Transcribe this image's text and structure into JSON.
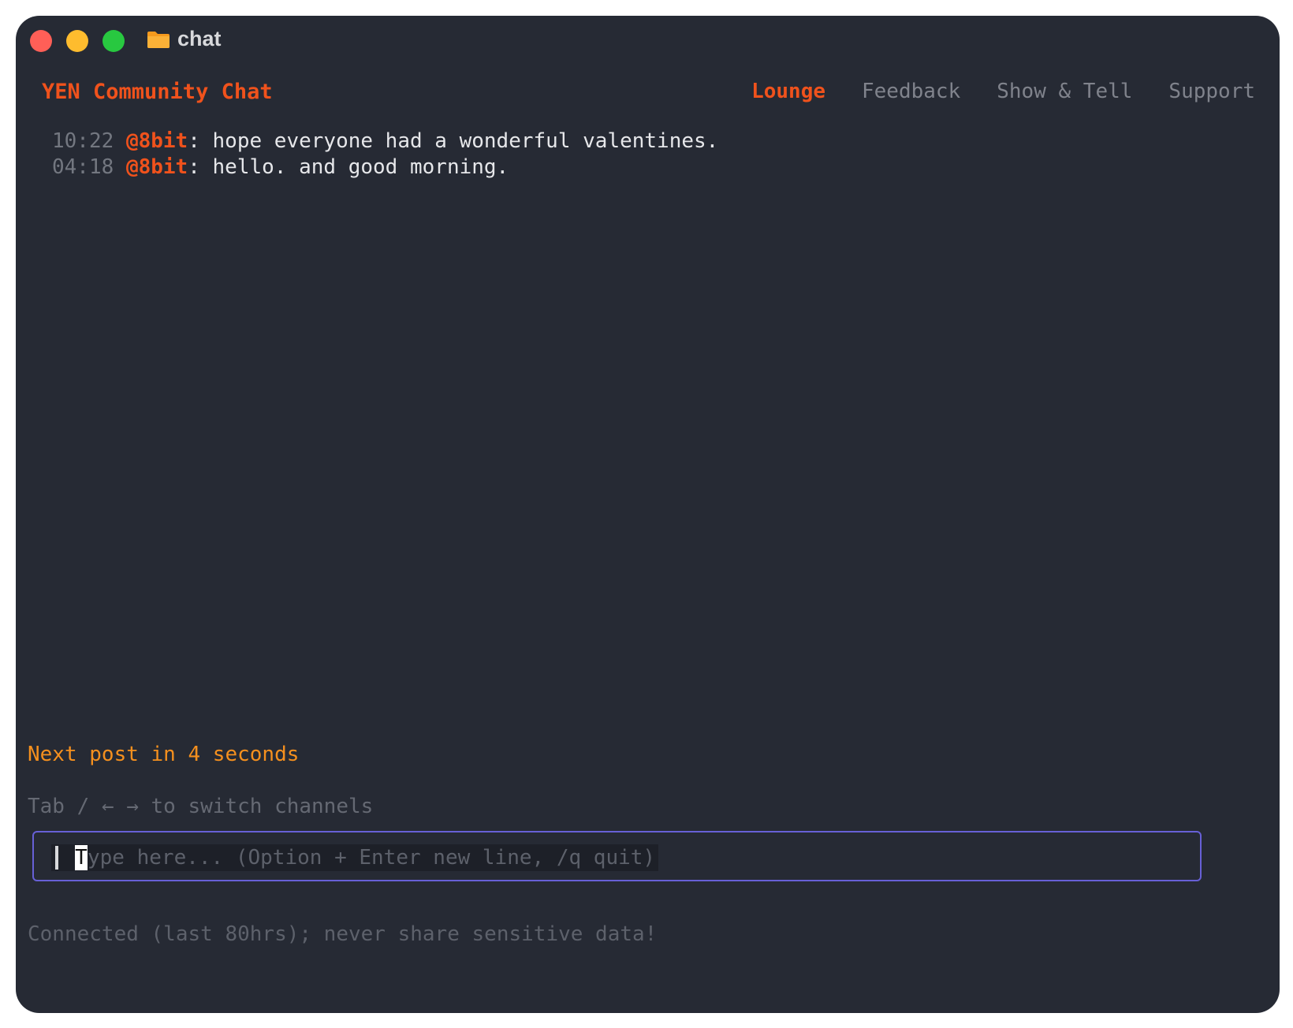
{
  "window": {
    "title": "chat",
    "folder_icon": "folder-icon"
  },
  "header": {
    "app_title": "YEN Community Chat",
    "channels": [
      {
        "label": "Lounge",
        "active": true
      },
      {
        "label": "Feedback",
        "active": false
      },
      {
        "label": "Show & Tell",
        "active": false
      },
      {
        "label": "Support",
        "active": false
      }
    ]
  },
  "messages": [
    {
      "time": "10:22",
      "user": "@8bit",
      "text": "hope everyone had a wonderful valentines."
    },
    {
      "time": "04:18",
      "user": "@8bit",
      "text": "hello. and good morning."
    }
  ],
  "status": {
    "countdown": "Next post in 4 seconds",
    "hint": "Tab / ← → to switch channels",
    "footer": "Connected (last 80hrs); never share sensitive data!"
  },
  "input": {
    "caret_char": "T",
    "placeholder_rest": "ype here... (Option + Enter new line, /q quit)"
  },
  "colors": {
    "accent": "#f0521c",
    "countdown": "#f5901e",
    "input_border": "#6760d6",
    "background": "#262a34"
  }
}
